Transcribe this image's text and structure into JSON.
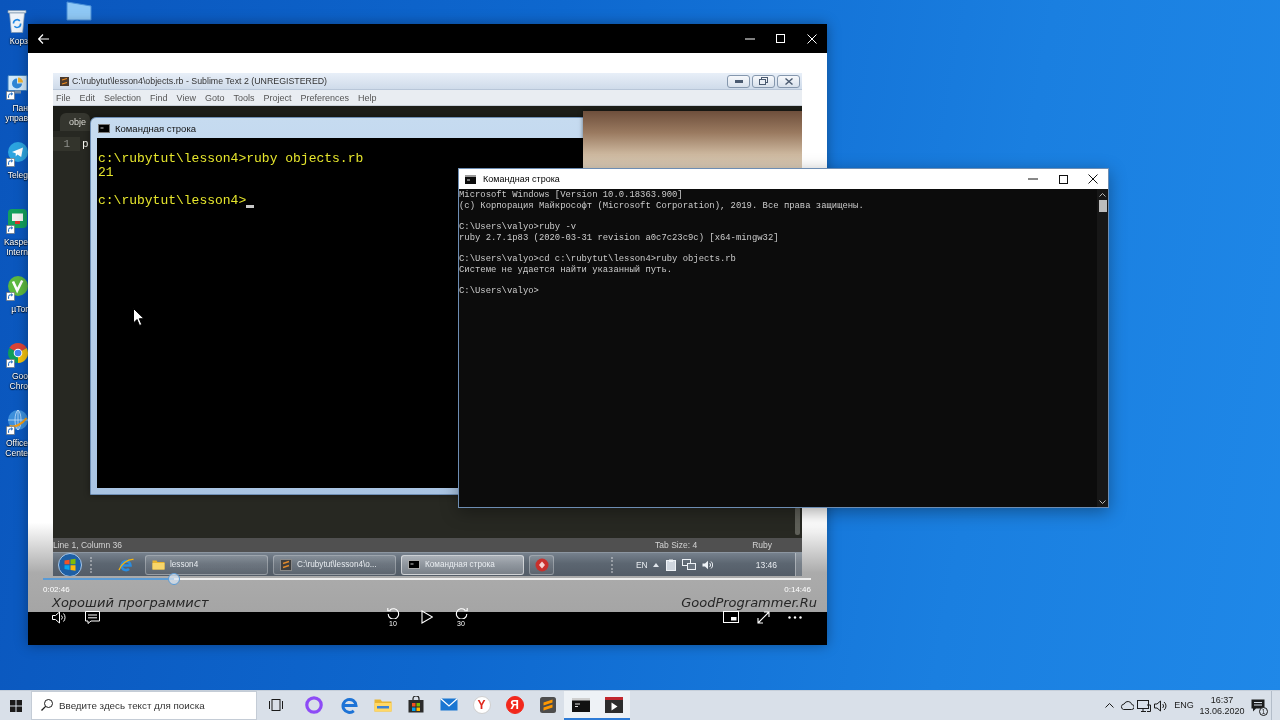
{
  "desktop_icons": [
    {
      "kind": "recycle-bin",
      "label": [
        "Корз"
      ]
    },
    {
      "kind": "control-panel",
      "label": [
        "Пан",
        "управ"
      ]
    },
    {
      "kind": "telegram",
      "label": [
        "Teleg"
      ]
    },
    {
      "kind": "kaspersky",
      "label": [
        "Kaspe",
        "Intern"
      ]
    },
    {
      "kind": "utorrent",
      "label": [
        "µTor"
      ]
    },
    {
      "kind": "chrome",
      "label": [
        "Goo",
        "Chro"
      ]
    },
    {
      "kind": "office",
      "label": [
        "Office",
        "Cente"
      ]
    }
  ],
  "video_player": {
    "recording": {
      "editor": {
        "title": "C:\\rubytut\\lesson4\\objects.rb - Sublime Text 2 (UNREGISTERED)",
        "menu": [
          "File",
          "Edit",
          "Selection",
          "Find",
          "View",
          "Goto",
          "Tools",
          "Project",
          "Preferences",
          "Help"
        ],
        "tab": "obje",
        "line_number": "1",
        "code": "p",
        "status": "Line 1, Column 36",
        "status_right": [
          "Tab Size: 4",
          "Ruby"
        ]
      },
      "console": {
        "title": "Командная строка",
        "blocks": [
          [
            "c:\\rubytut\\lesson4>ruby objects.rb",
            "21"
          ],
          [
            "c:\\rubytut\\lesson4>"
          ]
        ],
        "cursor": true
      },
      "taskbar": {
        "tasks": [
          {
            "kind": "folder",
            "label": "lesson4",
            "active": false
          },
          {
            "kind": "editor",
            "label": "C:\\rubytut\\lesson4\\o...",
            "active": false
          },
          {
            "kind": "console",
            "label": "Командная строка",
            "active": true
          },
          {
            "kind": "ruby",
            "active": false
          }
        ],
        "language": "EN",
        "clock": "13:46"
      },
      "watermarks": [
        "Хороший программист",
        "GoodProgrammer.Ru"
      ]
    },
    "controls": {
      "elapsed": "0:02:46",
      "total": "0:14:46",
      "level": 0.17,
      "playing": false,
      "skip_back": "10",
      "skip_forward": "30"
    }
  },
  "console_window": {
    "title": "Командная строка",
    "blocks": [
      [
        "Microsoft Windows [Version 10.0.18363.900]",
        "(c) Корпорация Майкрософт (Microsoft Corporation), 2019. Все права защищены."
      ],
      [
        "C:\\Users\\valyo>ruby -v",
        "ruby 2.7.1p83 (2020-03-31 revision a0c7c23c9c) [x64-mingw32]"
      ],
      [
        "C:\\Users\\valyo>cd c:\\rubytut\\lesson4>ruby objects.rb",
        "Системе не удается найти указанный путь."
      ],
      [
        "C:\\Users\\valyo>"
      ]
    ]
  },
  "taskbar": {
    "search": {
      "placeholder": "Введите здесь текст для поиска"
    },
    "apps": [
      {
        "kind": "task-view",
        "active": false
      },
      {
        "kind": "alice",
        "active": false
      },
      {
        "kind": "edge",
        "active": false
      },
      {
        "kind": "explorer",
        "active": false
      },
      {
        "kind": "store",
        "active": false
      },
      {
        "kind": "mail",
        "active": false
      },
      {
        "kind": "yandex-browser",
        "glyph": "Y",
        "active": false
      },
      {
        "kind": "yandex",
        "glyph": "Я",
        "active": false
      },
      {
        "kind": "sublime",
        "active": false
      },
      {
        "kind": "console",
        "active": true
      },
      {
        "kind": "movies",
        "active": true
      }
    ],
    "language": "ENG",
    "time": "16:37",
    "date": "13.06.2020",
    "notification_count": "1"
  }
}
